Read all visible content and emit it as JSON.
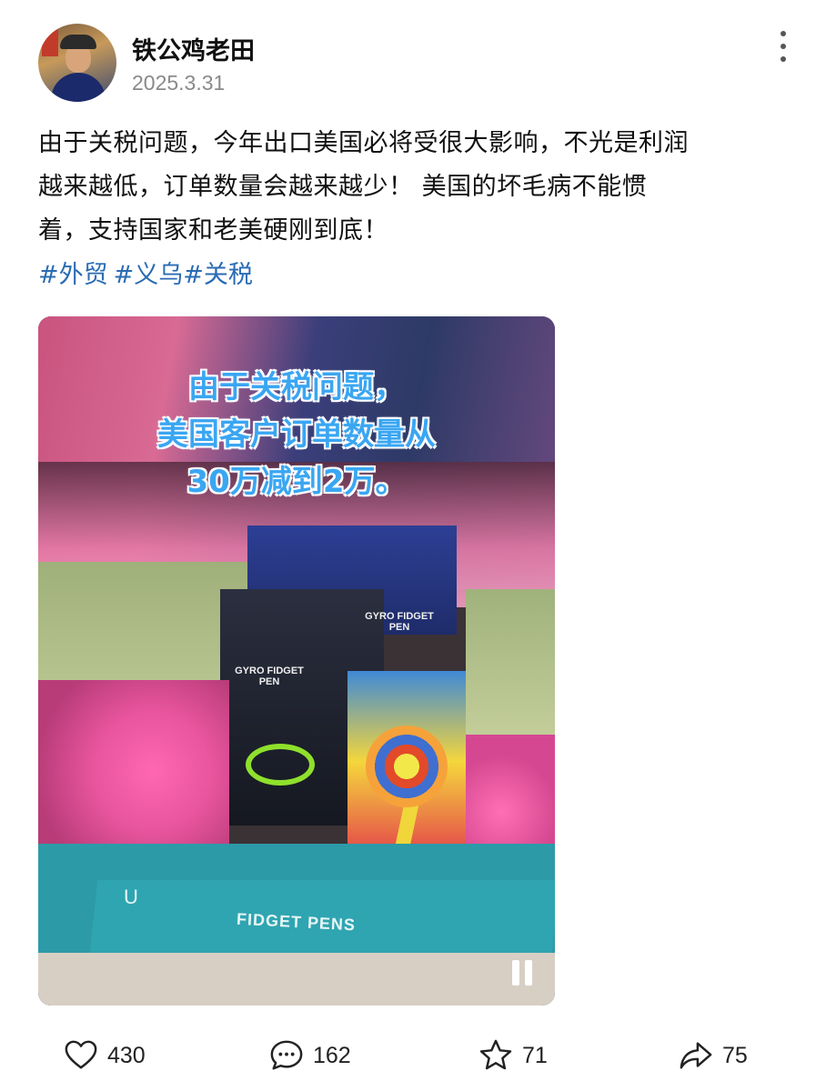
{
  "author": {
    "name": "铁公鸡老田",
    "date": "2025.3.31",
    "avatar_icon": "avatar-photo"
  },
  "post": {
    "lines": [
      "由于关税问题，今年出口美国必将受很大影响，不光是利润",
      "越来越低，订单数量会越来越少！ 美国的坏毛病不能惯",
      "着，支持国家和老美硬刚到底！"
    ],
    "tags": [
      "#外贸",
      "#义乌#关税"
    ]
  },
  "video": {
    "overlay_lines": [
      "由于关税问题，",
      "美国客户订单数量从",
      "30万减到2万。"
    ],
    "box_label": "FIDGET PENS",
    "box_logo": "U",
    "pack_label": "GYRO FIDGET PEN",
    "state": "playing"
  },
  "actions": {
    "like": {
      "icon": "heart-icon",
      "count": "430"
    },
    "comment": {
      "icon": "comment-icon",
      "count": "162"
    },
    "favorite": {
      "icon": "star-icon",
      "count": "71"
    },
    "share": {
      "icon": "share-icon",
      "count": "75"
    }
  },
  "colors": {
    "tag": "#2a6bb3",
    "overlay_text": "#3aa6f2",
    "date": "#8a8a8a"
  }
}
